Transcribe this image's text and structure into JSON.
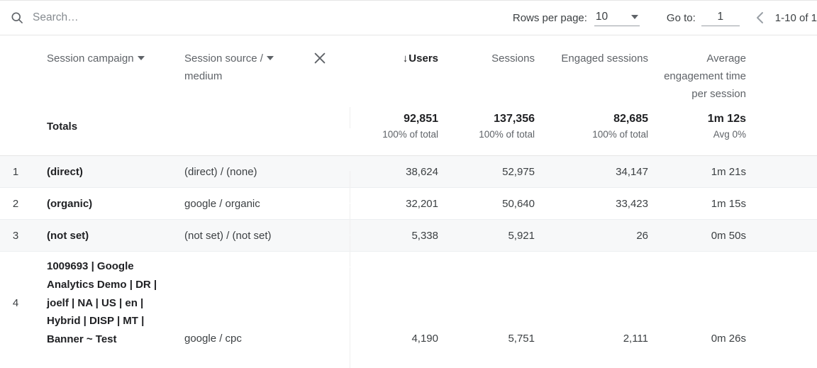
{
  "toolbar": {
    "search_placeholder": "Search…",
    "search_value": "",
    "search_icon": "search-icon",
    "rows_per_page_label": "Rows per page:",
    "rows_per_page_value": "10",
    "rows_per_page_caret": "chevron-down-icon",
    "goto_label": "Go to:",
    "goto_value": "1",
    "prev_page_icon": "chevron-left-icon",
    "page_range": "1-10 of 1"
  },
  "columns": {
    "dimension1": "Session campaign",
    "dimension2": "Session source / medium",
    "dimension2_line1": "Session source /",
    "dimension2_line2": "medium",
    "remove_icon": "close-icon",
    "metric1": "Users",
    "metric1_sort": "↓",
    "metric2": "Sessions",
    "metric3": "Engaged sessions",
    "metric4_line1": "Average",
    "metric4_line2": "engagement time",
    "metric4_line3": "per session"
  },
  "totals": {
    "label": "Totals",
    "users": "92,851",
    "users_sub": "100% of total",
    "sessions": "137,356",
    "sessions_sub": "100% of total",
    "engaged": "82,685",
    "engaged_sub": "100% of total",
    "avg_time": "1m 12s",
    "avg_time_sub": "Avg 0%"
  },
  "rows": [
    {
      "index": "1",
      "campaign": "(direct)",
      "source_medium": "(direct) / (none)",
      "users": "38,624",
      "sessions": "52,975",
      "engaged": "34,147",
      "avg_time": "1m 21s"
    },
    {
      "index": "2",
      "campaign": "(organic)",
      "source_medium": "google / organic",
      "users": "32,201",
      "sessions": "50,640",
      "engaged": "33,423",
      "avg_time": "1m 15s"
    },
    {
      "index": "3",
      "campaign": "(not set)",
      "source_medium": "(not set) / (not set)",
      "users": "5,338",
      "sessions": "5,921",
      "engaged": "26",
      "avg_time": "0m 50s"
    },
    {
      "index": "4",
      "campaign": "1009693 | Google Analytics Demo | DR | joelf | NA | US | en | Hybrid | DISP | MT | Banner ~ Test",
      "source_medium": "google / cpc",
      "users": "4,190",
      "sessions": "5,751",
      "engaged": "2,111",
      "avg_time": "0m 26s"
    }
  ]
}
